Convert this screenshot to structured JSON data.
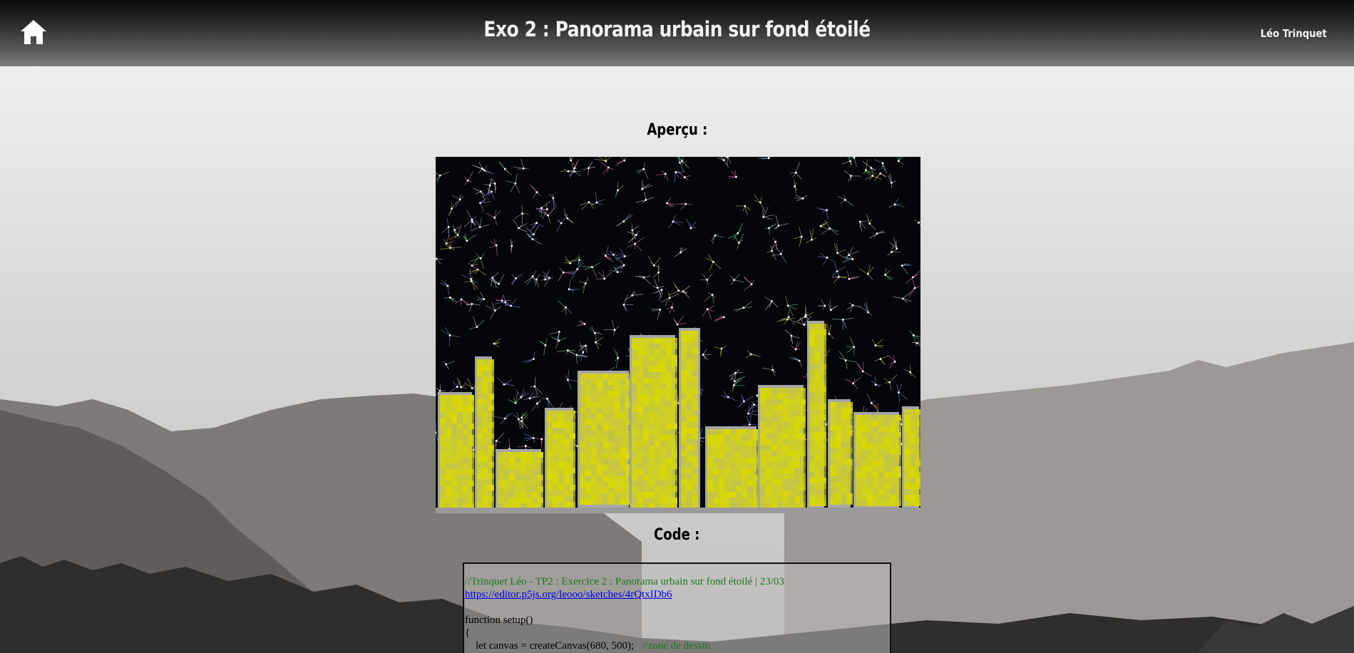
{
  "header": {
    "title": "Exo 2 : Panorama urbain sur fond étoilé",
    "author": "Léo Trinquet",
    "home_icon": "home-icon"
  },
  "sections": {
    "preview_title": "Aperçu :",
    "code_title": "Code :"
  },
  "preview": {
    "sky_color": "#05060a",
    "building_color": "#a6a6a6",
    "window_color": "#d9d900"
  },
  "code": {
    "comment_line": "//Trinquet Léo - TP2 : Exercice 2 : Panorama urbain sur fond étoilé | 23/03",
    "link": "https://editor.p5js.org/leooo/sketches/4rQtxIDb6",
    "blank": "",
    "line_setup": "function setup()",
    "line_brace": "{",
    "line_canvas_code": "    let canvas = createCanvas(680, 500);",
    "line_canvas_comment": "//zone de dessin"
  }
}
